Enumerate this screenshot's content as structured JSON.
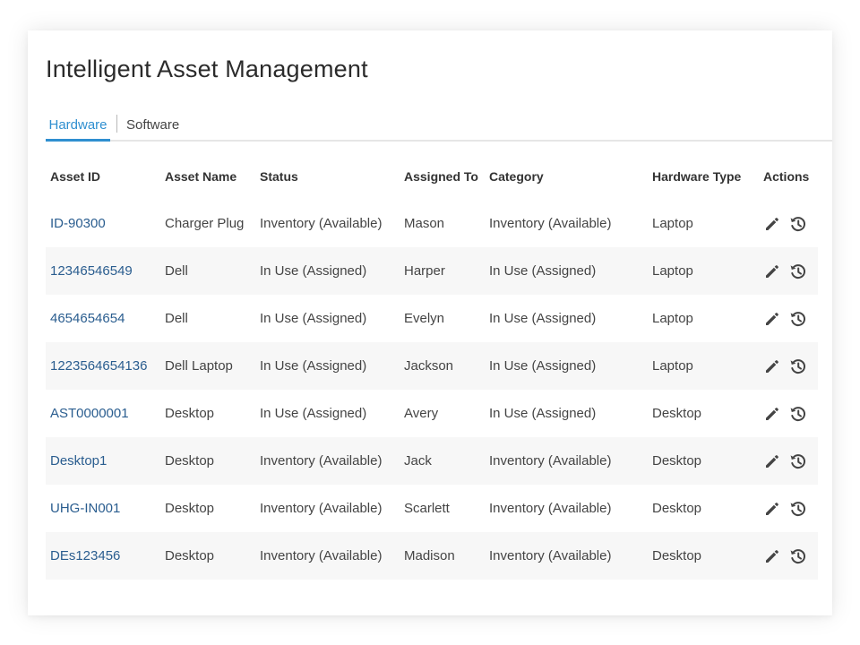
{
  "page": {
    "title": "Intelligent Asset Management"
  },
  "tabs": [
    {
      "label": "Hardware",
      "active": true
    },
    {
      "label": "Software",
      "active": false
    }
  ],
  "colors": {
    "accent": "#2f8fd0",
    "link": "#2a5d8f",
    "row_alt": "#f7f7f7"
  },
  "table": {
    "headers": [
      "Asset ID",
      "Asset Name",
      "Status",
      "Assigned To",
      "Category",
      "Hardware Type",
      "Actions"
    ],
    "action_icons": [
      "edit-pencil-icon",
      "history-icon"
    ],
    "rows": [
      [
        "ID-90300",
        "Charger Plug",
        "Inventory (Available)",
        "Mason",
        "Inventory (Available)",
        "Laptop"
      ],
      [
        "12346546549",
        "Dell",
        "In Use (Assigned)",
        "Harper",
        "In Use (Assigned)",
        "Laptop"
      ],
      [
        "4654654654",
        "Dell",
        "In Use (Assigned)",
        "Evelyn",
        "In Use (Assigned)",
        "Laptop"
      ],
      [
        "1223564654136",
        "Dell Laptop",
        "In Use (Assigned)",
        "Jackson",
        "In Use (Assigned)",
        "Laptop"
      ],
      [
        "AST0000001",
        "Desktop",
        "In Use (Assigned)",
        "Avery",
        "In Use (Assigned)",
        "Desktop"
      ],
      [
        "Desktop1",
        "Desktop",
        "Inventory (Available)",
        "Jack",
        "Inventory (Available)",
        "Desktop"
      ],
      [
        "UHG-IN001",
        "Desktop",
        "Inventory (Available)",
        "Scarlett",
        "Inventory (Available)",
        "Desktop"
      ],
      [
        "DEs123456",
        "Desktop",
        "Inventory (Available)",
        "Madison",
        "Inventory (Available)",
        "Desktop"
      ]
    ]
  }
}
